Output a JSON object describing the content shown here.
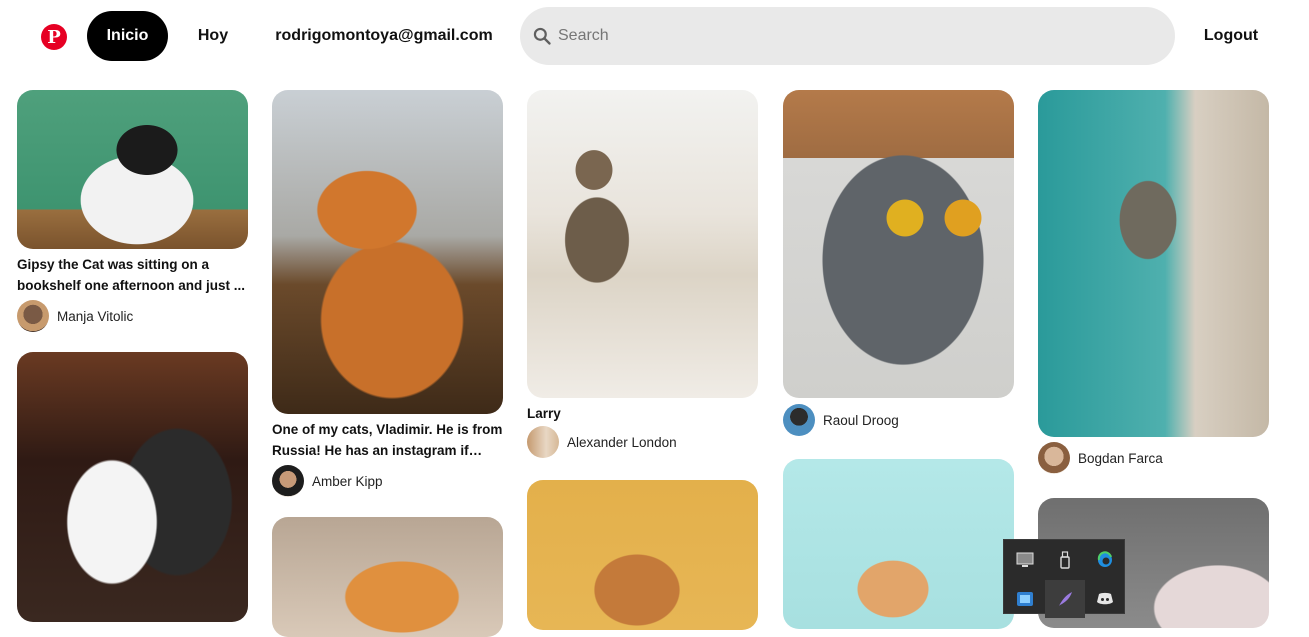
{
  "header": {
    "logo": "P",
    "nav": {
      "home": "Inicio",
      "today": "Hoy",
      "email": "rodrigomontoya@gmail.com",
      "logout": "Logout"
    },
    "search": {
      "placeholder": "Search",
      "value": ""
    }
  },
  "pins": [
    {
      "title": "Gipsy the Cat was sitting on a bookshelf one afternoon and just ...",
      "author": "Manja Vitolic"
    },
    {
      "title": "One of my cats, Vladimir. He is from Russia! He has an instagram if you...",
      "author": "Amber Kipp"
    },
    {
      "title": "Larry",
      "author": "Alexander London"
    },
    {
      "title": "",
      "author": "Raoul Droog"
    },
    {
      "title": "",
      "author": "Bogdan Farca"
    }
  ],
  "tray": {
    "icons": [
      "monitor-icon",
      "usb-drive-icon",
      "edge-icon",
      "network-app-icon",
      "feather-pen-icon",
      "discord-icon"
    ]
  },
  "colors": {
    "brand": "#e60023",
    "nav_active_bg": "#000000",
    "search_bg": "#e9e9e9"
  }
}
